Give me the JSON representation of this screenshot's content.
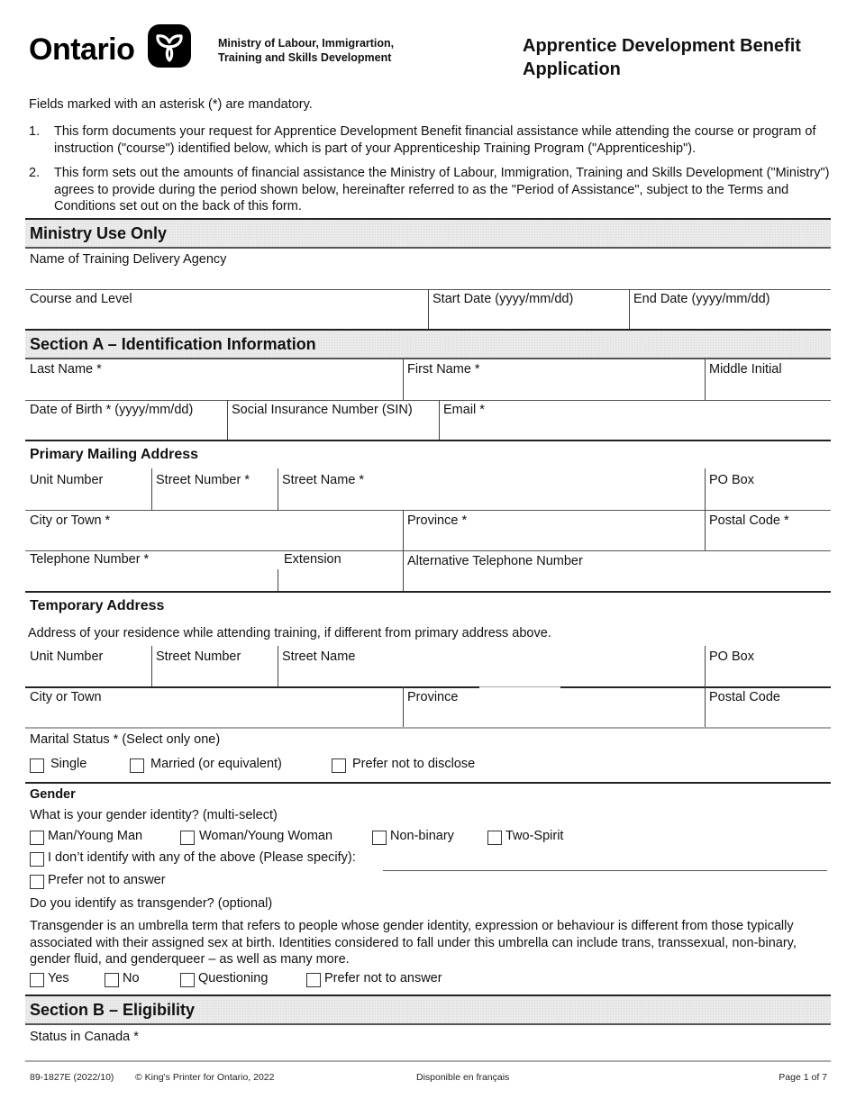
{
  "header": {
    "logo_text": "Ontario",
    "logo_icon": "trillium-icon",
    "ministry_line1": "Ministry of Labour, Immigrartion,",
    "ministry_line2": "Training and Skills Development",
    "title_line1": "Apprentice Development Benefit",
    "title_line2": "Application"
  },
  "intro": {
    "mandatory_note": "Fields marked with an asterisk (*) are mandatory.",
    "items": [
      {
        "num": "1.",
        "text": "This form documents your request for Apprentice Development Benefit financial assistance while attending the course or program of instruction (\"course\") identified below, which is part of your Apprenticeship Training Program (\"Apprenticeship\")."
      },
      {
        "num": "2.",
        "text": "This form sets out the amounts of financial assistance the Ministry of Labour, Immigration, Training and Skills Development (\"Ministry\") agrees to provide during the period shown below, hereinafter referred to as the \"Period of Assistance\", subject to the Terms  and Conditions set out on the back of this form."
      }
    ]
  },
  "ministry_use": {
    "title": "Ministry Use Only",
    "training_agency_label": "Name of Training Delivery Agency",
    "training_agency_value": "",
    "course_level_label": "Course and Level",
    "course_level_value": "",
    "start_date_label": "Start Date (yyyy/mm/dd)",
    "start_date_value": "",
    "end_date_label": "End Date (yyyy/mm/dd)",
    "end_date_value": ""
  },
  "section_a": {
    "title": "Section A – Identification Information",
    "last_name_label": "Last Name *",
    "first_name_label": "First Name *",
    "middle_initial_label": "Middle Initial",
    "dob_label": "Date of Birth * (yyyy/mm/dd)",
    "sin_label": "Social Insurance Number (SIN)",
    "email_label": "Email *",
    "values": {
      "last_name": "",
      "first_name": "",
      "middle_initial": "",
      "dob": "",
      "sin": "",
      "email": ""
    }
  },
  "primary_address": {
    "title": "Primary Mailing Address",
    "unit_label": "Unit Number",
    "street_number_label": "Street Number *",
    "street_name_label": "Street Name *",
    "po_box_label": "PO Box",
    "city_label": "City or Town *",
    "province_label": "Province *",
    "postal_label": "Postal Code *",
    "phone_label": "Telephone Number *",
    "extension_label": "Extension",
    "alt_phone_label": "Alternative Telephone Number"
  },
  "temporary_address": {
    "title": "Temporary Address",
    "description": "Address of your residence while attending training, if different from primary address above.",
    "unit_label": "Unit Number",
    "street_number_label": "Street Number",
    "street_name_label": "Street Name",
    "po_box_label": "PO Box",
    "city_label": "City or Town",
    "province_label": "Province",
    "postal_label": "Postal Code"
  },
  "marital": {
    "label": "Marital Status * (Select only one)",
    "options": [
      {
        "label": "Single",
        "checked": false
      },
      {
        "label": "Married (or equivalent)",
        "checked": false
      },
      {
        "label": "Prefer not to disclose",
        "checked": false
      }
    ]
  },
  "gender": {
    "title": "Gender",
    "question": "What is your gender identity? (multi-select)",
    "options": [
      {
        "label": "Man/Young Man",
        "checked": false
      },
      {
        "label": "Woman/Young Woman",
        "checked": false
      },
      {
        "label": "Non-binary",
        "checked": false
      },
      {
        "label": "Two-Spirit",
        "checked": false
      },
      {
        "label": "I don’t identify with any of the above (Please specify):",
        "checked": false
      },
      {
        "label": "Prefer not to answer",
        "checked": false
      }
    ],
    "specify_value": "",
    "transgender_question": "Do you identify as transgender? (optional)",
    "transgender_note": "Transgender is an umbrella term that refers to people whose gender identity, expression or behaviour is different from those typically associated with their assigned sex at birth. Identities considered to fall under this umbrella can include trans, transsexual, non-binary, gender fluid, and genderqueer – as well as many more.",
    "transgender_options": [
      {
        "label": "Yes",
        "checked": false
      },
      {
        "label": "No",
        "checked": false
      },
      {
        "label": "Questioning",
        "checked": false
      },
      {
        "label": "Prefer not to answer",
        "checked": false
      }
    ]
  },
  "section_b": {
    "title": "Section B – Eligibility",
    "status_label": "Status in Canada *",
    "status_value": ""
  },
  "footer": {
    "form_number": "89-1827E (2022/10)",
    "copyright": "© King's Printer for Ontario, 2022",
    "french": "Disponible en français",
    "page": "Page 1 of 7"
  }
}
